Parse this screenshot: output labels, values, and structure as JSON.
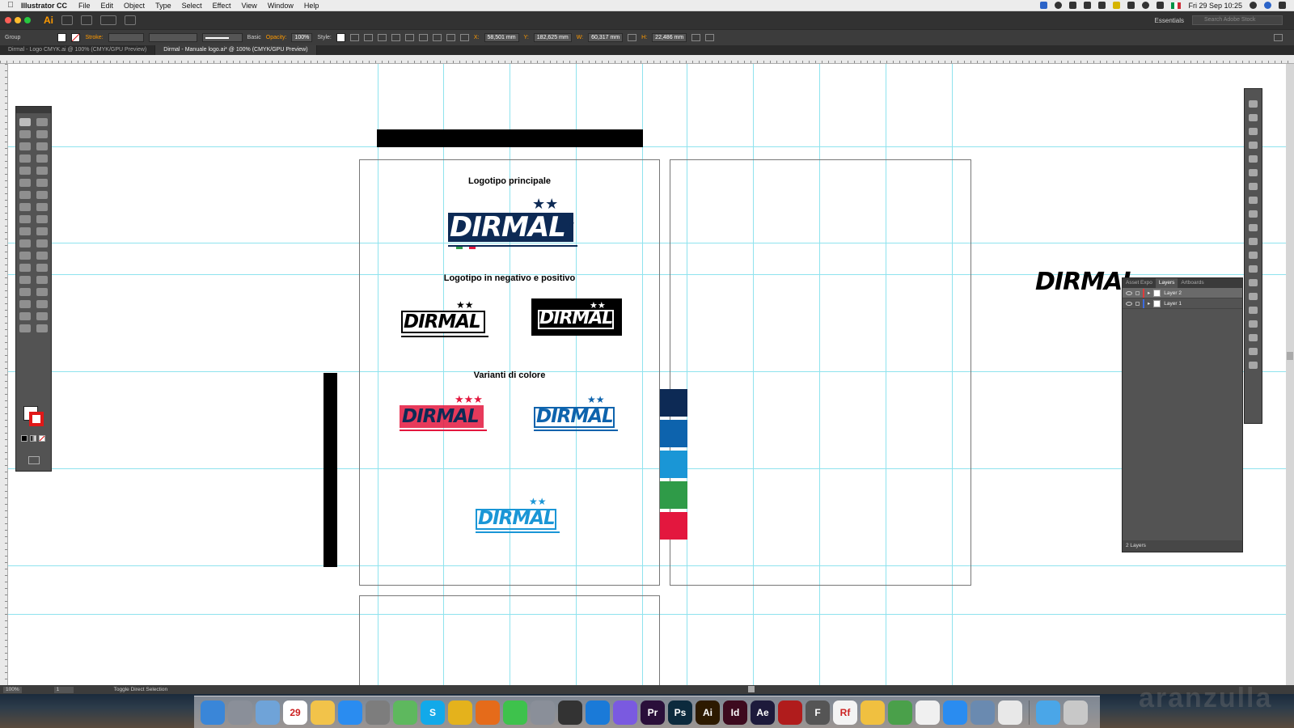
{
  "menubar": {
    "app_name": "Illustrator CC",
    "menus": [
      "File",
      "Edit",
      "Object",
      "Type",
      "Select",
      "Effect",
      "View",
      "Window",
      "Help"
    ],
    "clock": "Fri 29 Sep  10:25"
  },
  "appbar": {
    "logo": "Ai",
    "workspace": "Essentials",
    "stock_search_placeholder": "Search Adobe Stock"
  },
  "control": {
    "selection": "Group",
    "stroke_label": "Stroke:",
    "brush": "Basic",
    "opacity_label": "Opacity:",
    "opacity": "100%",
    "style_label": "Style:",
    "x_label": "X:",
    "x": "58,501 mm",
    "y_label": "Y:",
    "y": "182,625 mm",
    "w_label": "W:",
    "w": "60,317 mm",
    "h_label": "H:",
    "h": "22,486 mm"
  },
  "tabs": [
    {
      "label": "Dirmal - Logo CMYK.ai @ 100% (CMYK/GPU Preview)"
    },
    {
      "label": "Dirmal - Manuale logo.ai* @ 100% (CMYK/GPU Preview)"
    }
  ],
  "artboard": {
    "heading_main": "Logotipo principale",
    "heading_neg": "Logotipo in negativo e positivo",
    "heading_var": "Varianti di colore",
    "logo_text": "DIRMAL",
    "outside_logo": "DIRMAL"
  },
  "colors": {
    "navy": "#0d2a55",
    "blue": "#0d63ad",
    "light_blue": "#1a96d6",
    "green": "#2f9b48",
    "red": "#e3173e",
    "accent": "#ff9a00"
  },
  "layers_panel": {
    "tabs": [
      "Asset Expo",
      "Layers",
      "Artboards"
    ],
    "layers": [
      {
        "name": "Layer 2",
        "color": "#e03b3b",
        "selected": true
      },
      {
        "name": "Layer 1",
        "color": "#3b6be0",
        "selected": false
      }
    ],
    "footer": "2 Layers"
  },
  "status": {
    "zoom": "100%",
    "artboard_num": "1",
    "tool_hint": "Toggle Direct Selection"
  },
  "dock": {
    "calendar_day": "29",
    "apps": [
      {
        "label": "",
        "color": "#3a86d8",
        "icon": "finder-icon"
      },
      {
        "label": "",
        "color": "#8a8f99",
        "icon": "launchpad-icon"
      },
      {
        "label": "",
        "color": "#6fa3d8",
        "icon": "preview-icon"
      },
      {
        "label": "29",
        "color": "#ffffff",
        "icon": "calendar-icon"
      },
      {
        "label": "",
        "color": "#f2c34a",
        "icon": "photos-icon"
      },
      {
        "label": "",
        "color": "#2a8cf0",
        "icon": "appstore-icon"
      },
      {
        "label": "",
        "color": "#7d7d7d",
        "icon": "system-preferences-icon"
      },
      {
        "label": "",
        "color": "#5eb85e",
        "icon": "maps-icon"
      },
      {
        "label": "S",
        "color": "#12a9e9",
        "icon": "skype-icon"
      },
      {
        "label": "",
        "color": "#e4b21c",
        "icon": "chrome-icon"
      },
      {
        "label": "",
        "color": "#e56b1a",
        "icon": "firefox-icon"
      },
      {
        "label": "",
        "color": "#3ec24c",
        "icon": "whatsapp-icon"
      },
      {
        "label": "",
        "color": "#8a8f99",
        "icon": "safari-icon"
      },
      {
        "label": "",
        "color": "#333333",
        "icon": "gamepad-icon"
      },
      {
        "label": "",
        "color": "#1a7ad8",
        "icon": "trello-icon"
      },
      {
        "label": "",
        "color": "#7a5ae0",
        "icon": "imovie-icon"
      },
      {
        "label": "Pr",
        "color": "#2a0f3a",
        "icon": "premiere-icon"
      },
      {
        "label": "Ps",
        "color": "#0c2a3d",
        "icon": "photoshop-icon"
      },
      {
        "label": "Ai",
        "color": "#2d1a00",
        "icon": "illustrator-icon"
      },
      {
        "label": "Id",
        "color": "#3d0a1e",
        "icon": "indesign-icon"
      },
      {
        "label": "Ae",
        "color": "#1d1a3b",
        "icon": "aftereffects-icon"
      },
      {
        "label": "",
        "color": "#b01c1c",
        "icon": "acrobat-icon"
      },
      {
        "label": "F",
        "color": "#555555",
        "icon": "fontbook-icon"
      },
      {
        "label": "Rf",
        "color": "#f3f3f3",
        "icon": "textedit-icon"
      },
      {
        "label": "",
        "color": "#f0c040",
        "icon": "pages-icon"
      },
      {
        "label": "",
        "color": "#4aa04a",
        "icon": "numbers-icon"
      },
      {
        "label": "",
        "color": "#f0f0f0",
        "icon": "keynote-icon"
      },
      {
        "label": "",
        "color": "#2a8cf0",
        "icon": "teamviewer-icon"
      },
      {
        "label": "",
        "color": "#6a8ab0",
        "icon": "mail-icon"
      },
      {
        "label": "",
        "color": "#e8e8e8",
        "icon": "notes-icon"
      },
      {
        "label": "",
        "color": "#4aa6e8",
        "icon": "downloads-folder-icon"
      },
      {
        "label": "",
        "color": "#c8c8c8",
        "icon": "trash-icon"
      }
    ]
  }
}
